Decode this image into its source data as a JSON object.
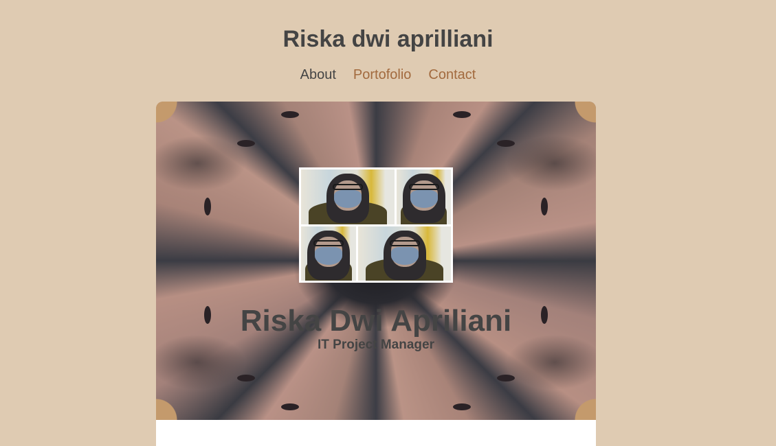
{
  "header": {
    "title": "Riska dwi aprilliani"
  },
  "nav": {
    "items": [
      {
        "label": "About"
      },
      {
        "label": "Portofolio"
      },
      {
        "label": "Contact"
      }
    ]
  },
  "hero": {
    "name": "Riska Dwi Apriliani",
    "role": "IT Project Manager"
  },
  "colors": {
    "background": "#dfcbb2",
    "text": "#444444",
    "link": "#a26a3e",
    "card": "#ffffff"
  }
}
